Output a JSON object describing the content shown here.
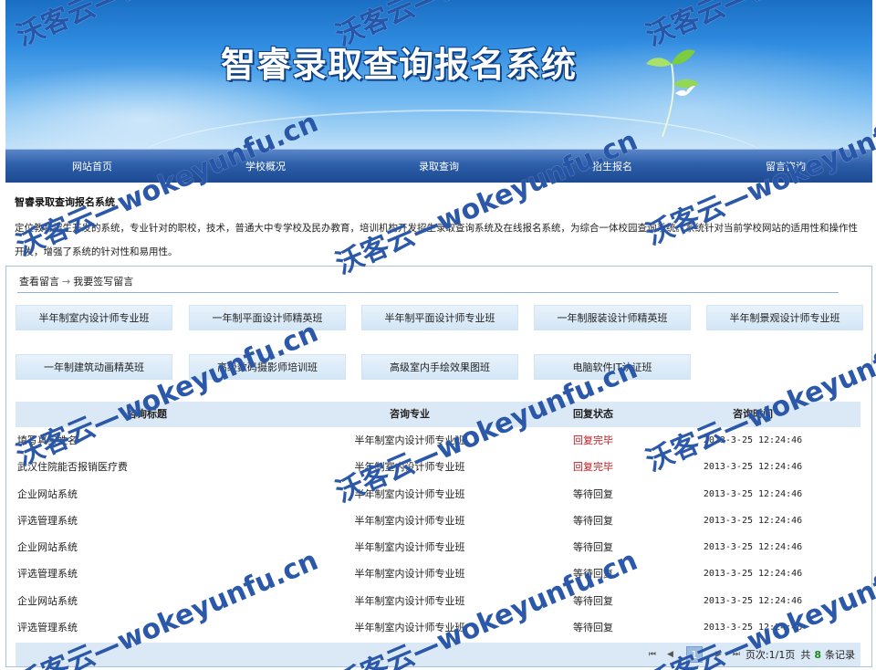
{
  "banner": {
    "title": "智睿录取查询报名系统"
  },
  "nav": {
    "items": [
      "网站首页",
      "学校概况",
      "录取查询",
      "招生报名",
      "留言咨询"
    ]
  },
  "intro": {
    "title": "智睿录取查询报名系统",
    "text": "定位教育招生开发的系统，专业针对的职校，技术，普通大中专学校及民办教育，培训机构开发招生录取查询系统及在线报名系统，为综合一体校园查询系统。系统针对当前学校网站的适用性和操作性开发，增强了系统的针对性和易用性。"
  },
  "breadcrumb": {
    "view": "查看留言",
    "arrow": "→",
    "write": "我要签写留言"
  },
  "courses": [
    "半年制室内设计师专业班",
    "一年制平面设计师精英班",
    "半年制平面设计师专业班",
    "一年制服装设计师精英班",
    "半年制景观设计师专业班",
    "一年制建筑动画精英班",
    "高级数码摄影师培训班",
    "高级室内手绘效果图班",
    "电脑软件IT认证班"
  ],
  "table": {
    "headers": [
      "咨询标题",
      "咨询专业",
      "回复状态",
      "咨询时间"
    ],
    "rows": [
      {
        "title": "填写真实姓名",
        "major": "半年制室内设计师专业班",
        "status": "回复完毕",
        "time": "2013-3-25 12:24:46",
        "done": true
      },
      {
        "title": "武汉住院能否报销医疗费",
        "major": "半年制室内设计师专业班",
        "status": "回复完毕",
        "time": "2013-3-25 12:24:46",
        "done": true
      },
      {
        "title": "企业网站系统",
        "major": "半年制室内设计师专业班",
        "status": "等待回复",
        "time": "2013-3-25 12:24:46",
        "done": false
      },
      {
        "title": "评选管理系统",
        "major": "半年制室内设计师专业班",
        "status": "等待回复",
        "time": "2013-3-25 12:24:46",
        "done": false
      },
      {
        "title": "企业网站系统",
        "major": "半年制室内设计师专业班",
        "status": "等待回复",
        "time": "2013-3-25 12:24:46",
        "done": false
      },
      {
        "title": "评选管理系统",
        "major": "半年制室内设计师专业班",
        "status": "等待回复",
        "time": "2013-3-25 12:24:46",
        "done": false
      },
      {
        "title": "企业网站系统",
        "major": "半年制室内设计师专业班",
        "status": "等待回复",
        "time": "2013-3-25 12:24:46",
        "done": false
      },
      {
        "title": "评选管理系统",
        "major": "半年制室内设计师专业班",
        "status": "等待回复",
        "time": "2013-3-25 12:24:46",
        "done": false
      }
    ]
  },
  "pager": {
    "first": "⏮",
    "prev": "◀",
    "current": "1",
    "next": "▶",
    "last": "⏭",
    "page_info": "页次:1/1页",
    "total_prefix": "共",
    "total_count": "8",
    "total_suffix": "条记录"
  },
  "watermark": {
    "text": "沃客云—wokeyunfu.cn"
  },
  "colors": {
    "nav": "#2d5ea9",
    "status_done": "#c0171c",
    "count": "#1c8a1c",
    "table_header": "#dbe8f5"
  }
}
